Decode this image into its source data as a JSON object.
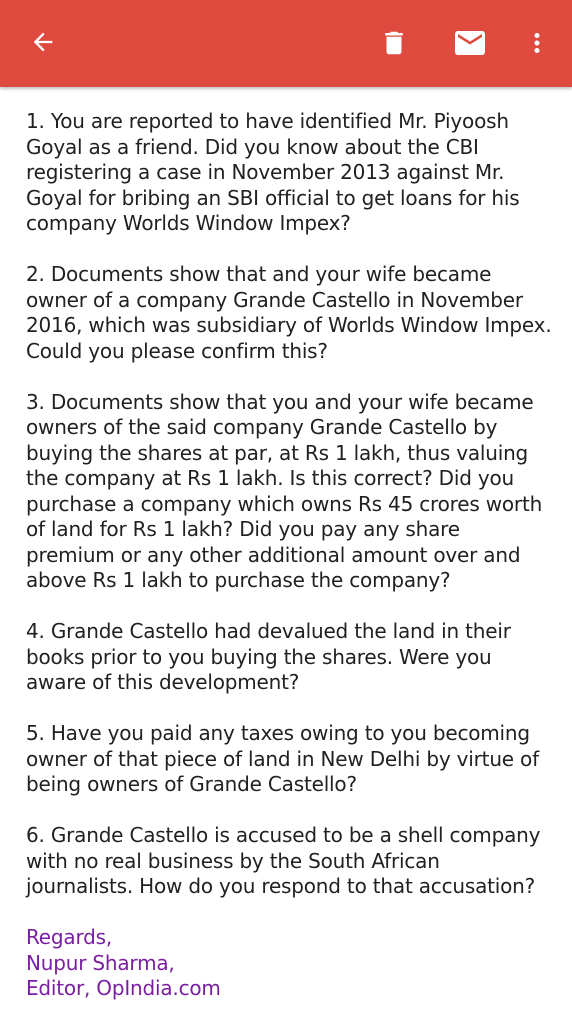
{
  "toolbar": {
    "back_icon": "arrow-back-icon",
    "delete_icon": "trash-icon",
    "mail_icon": "mail-icon",
    "more_icon": "more-vertical-icon",
    "bar_color": "#de4a3e"
  },
  "message": {
    "paragraphs": [
      "1. You are reported to have identified Mr. Piyoosh Goyal as a friend. Did you know about the CBI registering a case in November 2013 against Mr. Goyal for bribing an SBI official to get loans for his company Worlds Window Impex?",
      "2. Documents show that and your wife became owner of a company Grande Castello in November 2016, which was subsidiary of Worlds Window Impex. Could you please confirm this?",
      "3. Documents show that you and your wife became owners of the said company Grande Castello by buying the shares at par, at Rs 1 lakh, thus valuing the company at Rs 1 lakh. Is this correct? Did you purchase a company which owns Rs 45 crores worth of land for Rs 1 lakh? Did you pay any share premium or any other additional amount over and above Rs 1 lakh to purchase the company?",
      "4. Grande Castello had devalued the land in their books prior to you buying the shares. Were you aware of this development?",
      "5. Have you paid any taxes owing to you becoming owner of that piece of land in New Delhi by virtue of being owners of Grande Castello?",
      "6. Grande Castello is accused to be a shell company with no real business by the South African journalists. How do you respond to that accusation?"
    ],
    "signature": {
      "line1": "Regards,",
      "line2": "Nupur Sharma,",
      "line3": "Editor, OpIndia.com",
      "color": "#7b1fa2"
    }
  }
}
